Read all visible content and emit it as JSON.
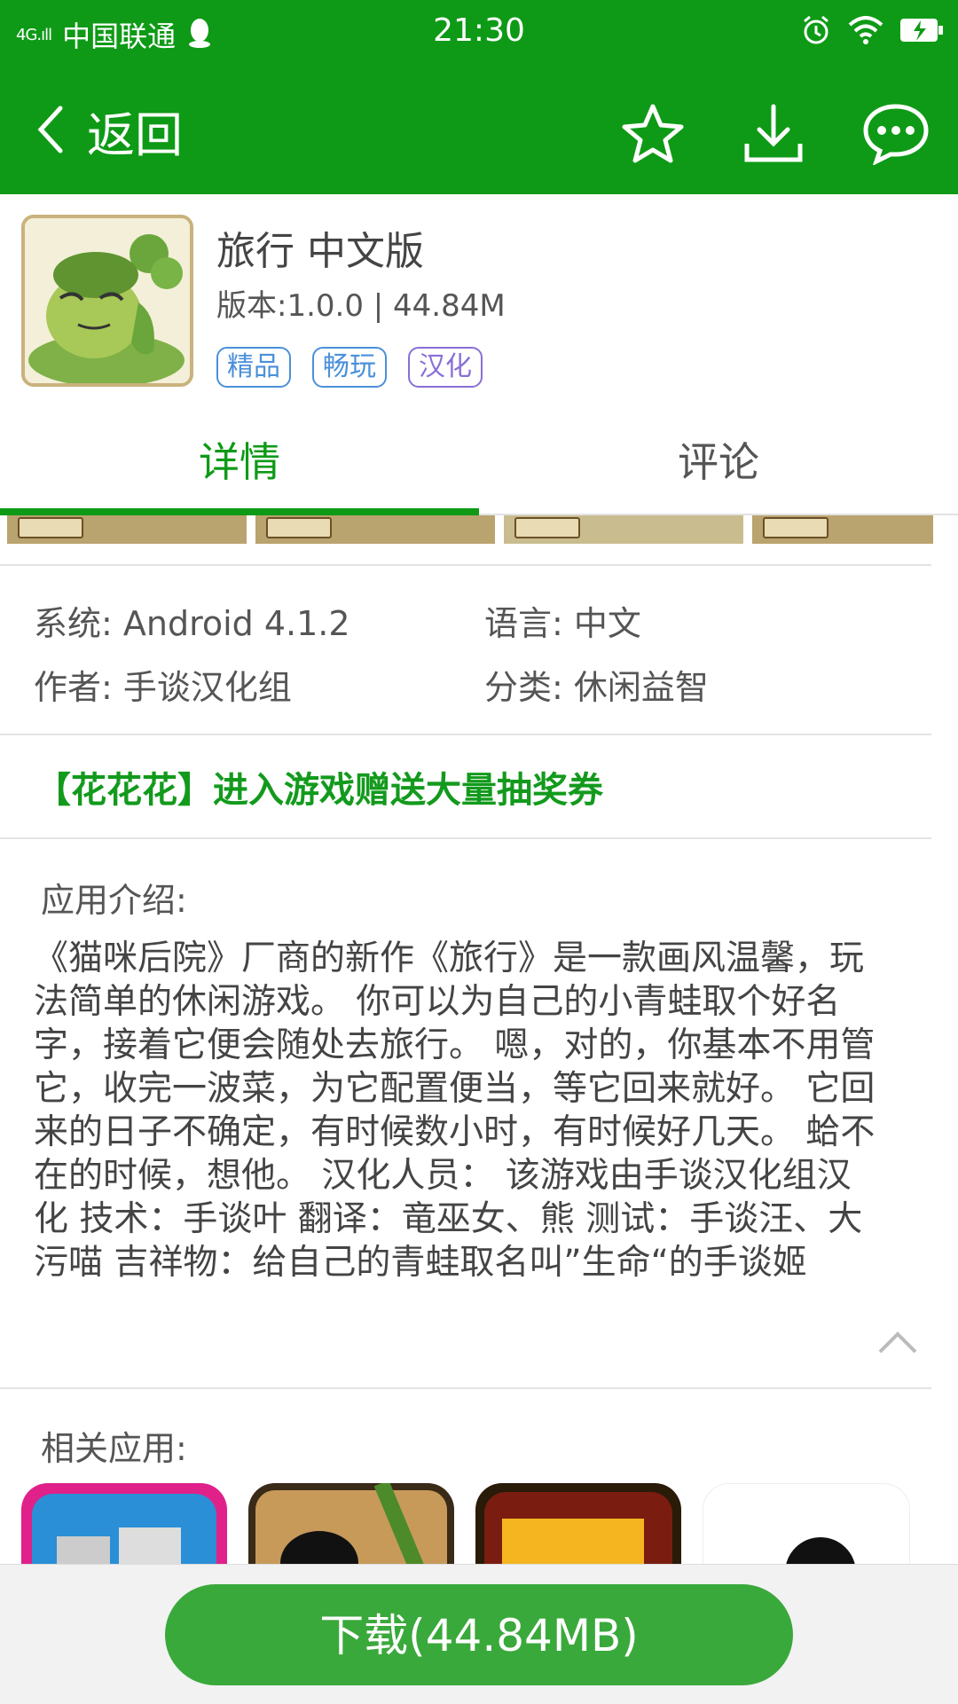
{
  "status_bar": {
    "signal": "4G.ıll",
    "carrier": "中国联通",
    "time": "21:30"
  },
  "titlebar": {
    "back_label": "返回",
    "icons": [
      "star-icon",
      "download-icon",
      "chat-icon"
    ],
    "bg_color": "#0e9a16"
  },
  "app": {
    "name": "旅行 中文版",
    "meta": "版本:1.0.0 | 44.84M",
    "tags": [
      {
        "label": "精品",
        "color": "#4a90d9"
      },
      {
        "label": "畅玩",
        "color": "#4a90d9"
      },
      {
        "label": "汉化",
        "color": "#8a6fd6"
      }
    ]
  },
  "tabs": [
    {
      "label": "详情",
      "active": true
    },
    {
      "label": "评论",
      "active": false
    }
  ],
  "info": {
    "system": "系统: Android 4.1.2",
    "language": "语言: 中文",
    "author": "作者: 手谈汉化组",
    "category": "分类: 休闲益智"
  },
  "promo": "【花花花】进入游戏赠送大量抽奖券",
  "intro": {
    "title": "应用介绍:",
    "text": "《猫咪后院》厂商的新作《旅行》是一款画风温馨，玩法简单的休闲游戏。 你可以为自己的小青蛙取个好名字，接着它便会随处去旅行。 嗯，对的，你基本不用管它，收完一波菜，为它配置便当，等它回来就好。 它回来的日子不确定，有时候数小时，有时候好几天。 蛤不在的时候，想他。 汉化人员： 该游戏由手谈汉化组汉化 技术：手谈叶 翻译：竜巫女、熊 测试：手谈汪、大污喵 吉祥物：给自己的青蛙取名叫”生命“的手谈姬"
  },
  "related": {
    "title": "相关应用:"
  },
  "download": {
    "label": "下载(44.84MB)",
    "color": "#3aa93b"
  }
}
